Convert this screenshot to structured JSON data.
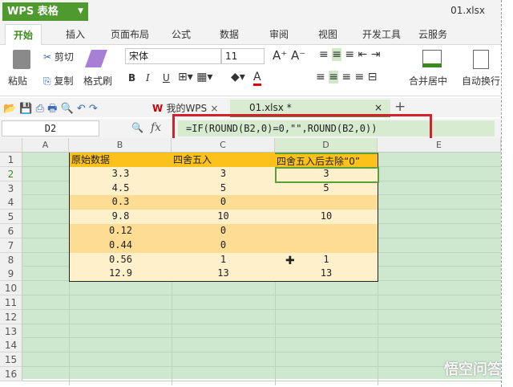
{
  "app": {
    "title": "WPS 表格",
    "doc_name": "01.xlsx"
  },
  "tabs": [
    "开始",
    "插入",
    "页面布局",
    "公式",
    "数据",
    "审阅",
    "视图",
    "开发工具",
    "云服务"
  ],
  "ribbon": {
    "paste": "粘贴",
    "cut": "剪切",
    "copy": "复制",
    "format_painter": "格式刷",
    "font": "宋体",
    "size": "11",
    "bold": "B",
    "italic": "I",
    "underline": "U",
    "font_color": "A",
    "merge": "合并居中",
    "wrap": "自动换行"
  },
  "doc_tabs": {
    "home": "我的WPS",
    "file": "01.xlsx *",
    "close": "×",
    "add": "+"
  },
  "formula_bar": {
    "cell": "D2",
    "fx": "fx",
    "formula": "=IF(ROUND(B2,0)=0,\"\",ROUND(B2,0))"
  },
  "columns": [
    "A",
    "B",
    "C",
    "D",
    "E"
  ],
  "rows": [
    "1",
    "2",
    "3",
    "4",
    "5",
    "6",
    "7",
    "8",
    "9",
    "10",
    "11",
    "12",
    "13",
    "14",
    "15",
    "16"
  ],
  "table": {
    "headers": [
      "原始数据",
      "四舍五入",
      "四舍五入后去除“0”"
    ],
    "data": [
      [
        "3.3",
        "3",
        "3"
      ],
      [
        "4.5",
        "5",
        "5"
      ],
      [
        "0.3",
        "0",
        ""
      ],
      [
        "9.8",
        "10",
        "10"
      ],
      [
        "0.12",
        "0",
        ""
      ],
      [
        "0.44",
        "0",
        ""
      ],
      [
        "0.56",
        "1",
        "1"
      ],
      [
        "12.9",
        "13",
        "13"
      ]
    ]
  },
  "colors": {
    "header": "#fcc21b",
    "row": "#fff0cc",
    "zero_row": "#fddc93",
    "grid_bg": "#cde8cf",
    "highlight": "#d2232a"
  },
  "watermark": "悟空问答"
}
